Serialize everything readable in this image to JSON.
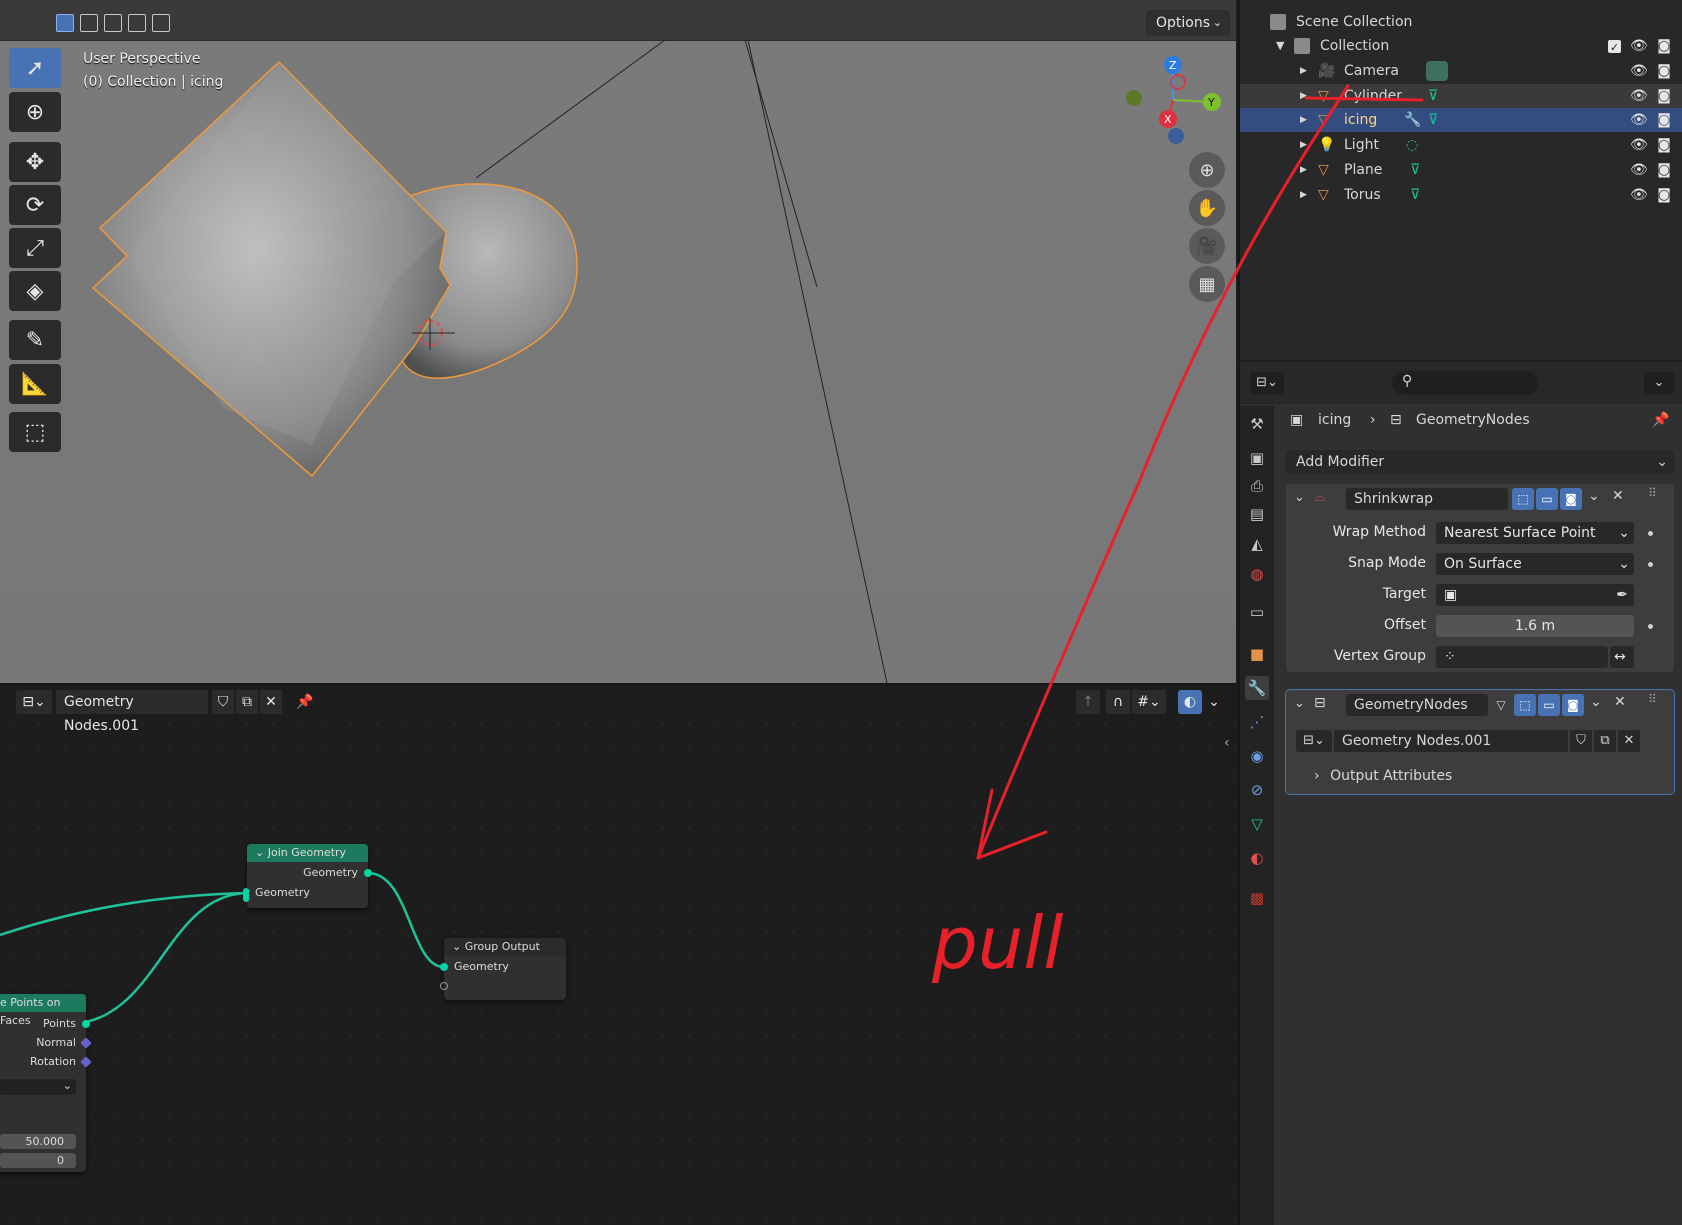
{
  "viewport": {
    "options_label": "Options",
    "overlay_line1": "User Perspective",
    "overlay_line2": "(0) Collection | icing",
    "gizmo": {
      "z": "Z",
      "y": "Y",
      "x": "X"
    }
  },
  "node_editor": {
    "node_group_name": "Geometry Nodes.001",
    "nodes": {
      "join": {
        "title": "Join Geometry",
        "out": "Geometry",
        "in": "Geometry"
      },
      "output": {
        "title": "Group Output",
        "in": "Geometry"
      },
      "points": {
        "title": "e Points on Faces",
        "out1": "Points",
        "out2": "Normal",
        "out3": "Rotation",
        "val1": "50.000",
        "val2": "0"
      }
    }
  },
  "outliner": {
    "scene_collection": "Scene Collection",
    "collection": "Collection",
    "items": [
      {
        "name": "Camera"
      },
      {
        "name": "Cylinder"
      },
      {
        "name": "icing"
      },
      {
        "name": "Light"
      },
      {
        "name": "Plane"
      },
      {
        "name": "Torus"
      }
    ]
  },
  "properties": {
    "breadcrumb_object": "icing",
    "breadcrumb_modifier": "GeometryNodes",
    "add_modifier": "Add Modifier",
    "shrinkwrap": {
      "name": "Shrinkwrap",
      "wrap_method_label": "Wrap Method",
      "wrap_method_value": "Nearest Surface Point",
      "snap_mode_label": "Snap Mode",
      "snap_mode_value": "On Surface",
      "target_label": "Target",
      "offset_label": "Offset",
      "offset_value": "1.6 m",
      "vertex_group_label": "Vertex Group"
    },
    "geometry_nodes": {
      "name": "GeometryNodes",
      "group": "Geometry Nodes.001",
      "output_attributes": "Output Attributes"
    }
  },
  "annotation": {
    "text": "pull",
    "color": "#e8202a"
  }
}
